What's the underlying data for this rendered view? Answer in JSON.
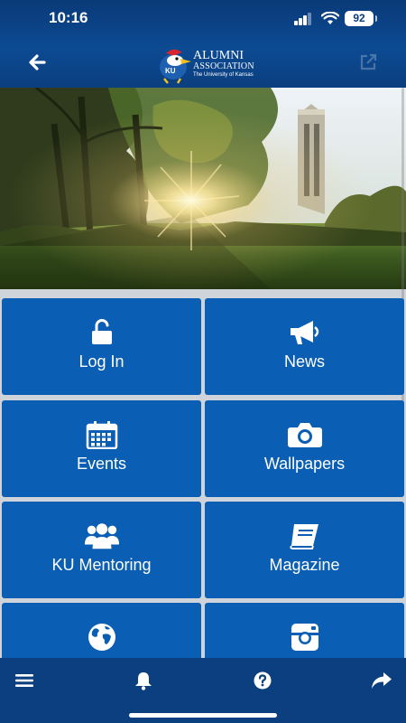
{
  "status_bar": {
    "time": "10:16",
    "battery": "92"
  },
  "header": {
    "logo_line1": "ALUMNI",
    "logo_line2": "ASSOCIATION",
    "logo_line3": "The University of Kansas",
    "logo_badge": "KU"
  },
  "tiles": [
    {
      "label": "Log In",
      "icon": "unlock-icon"
    },
    {
      "label": "News",
      "icon": "megaphone-icon"
    },
    {
      "label": "Events",
      "icon": "calendar-icon"
    },
    {
      "label": "Wallpapers",
      "icon": "camera-icon"
    },
    {
      "label": "KU Mentoring",
      "icon": "people-icon"
    },
    {
      "label": "Magazine",
      "icon": "book-icon"
    },
    {
      "label": "",
      "icon": "globe-icon"
    },
    {
      "label": "",
      "icon": "instagram-icon"
    }
  ],
  "tab_bar": {
    "icons": [
      "menu-icon",
      "bell-icon",
      "help-icon",
      "share-icon"
    ]
  },
  "colors": {
    "header": "#0b3f7f",
    "tile": "#0a5eb4",
    "background": "#cfd3da"
  }
}
